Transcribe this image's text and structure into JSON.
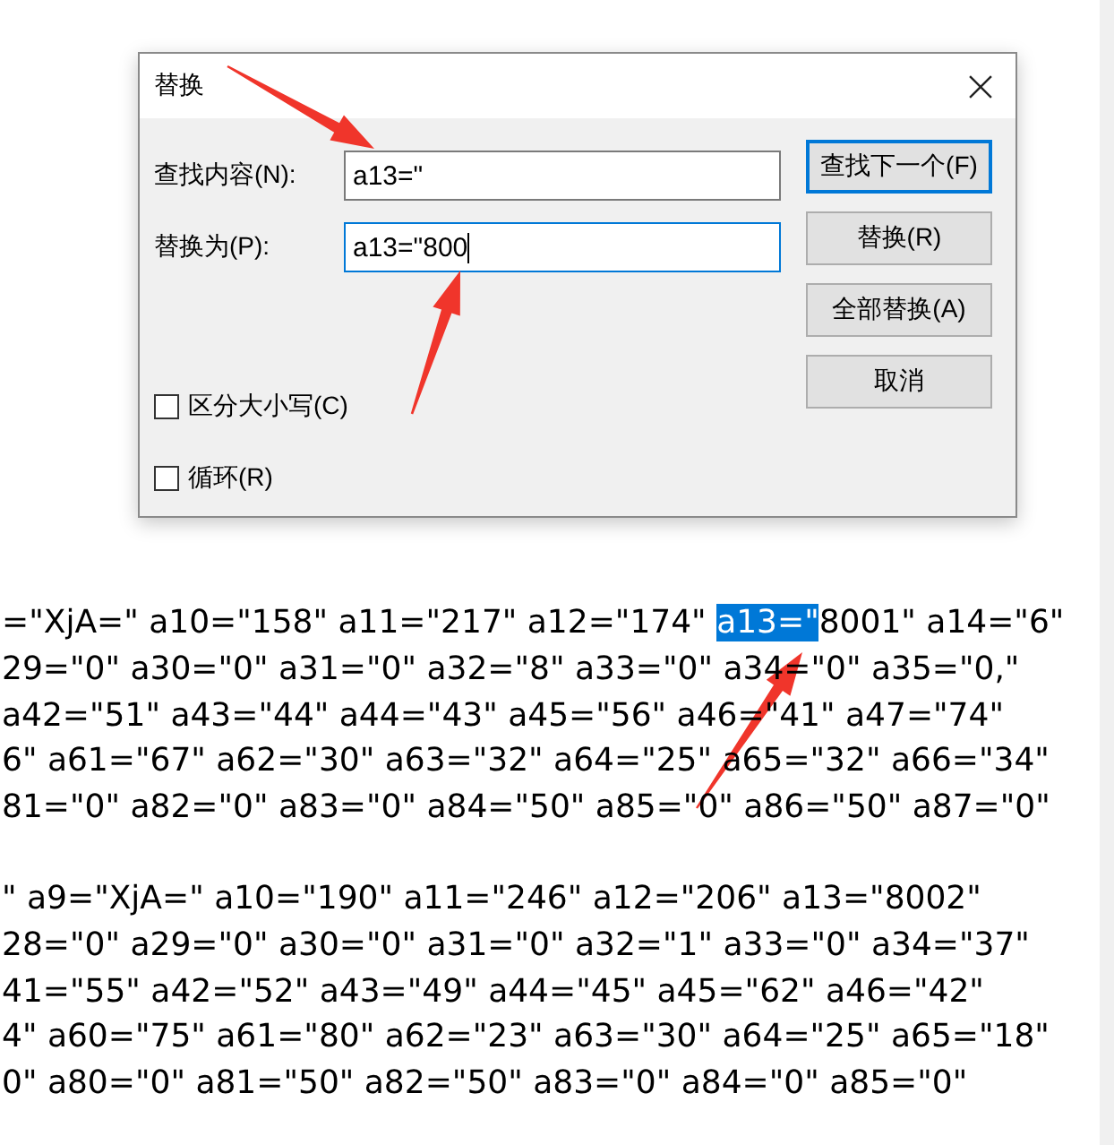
{
  "dialog": {
    "title": "替换",
    "fields": [
      {
        "label": "查找内容(N):",
        "value": "a13=\"",
        "focused": false
      },
      {
        "label": "替换为(P):",
        "value": "a13=\"800",
        "focused": true
      }
    ],
    "buttons": [
      {
        "label": "查找下一个(F)",
        "default": true
      },
      {
        "label": "替换(R)",
        "default": false
      },
      {
        "label": "全部替换(A)",
        "default": false
      },
      {
        "label": "取消",
        "default": false
      }
    ],
    "checkboxes": [
      {
        "label": "区分大小写(C)",
        "checked": false
      },
      {
        "label": "循环(R)",
        "checked": false
      }
    ]
  },
  "document": {
    "paragraphs": [
      {
        "lines": [
          {
            "segments": [
              {
                "text": "=\"XjA=\" a10=\"158\" a11=\"217\" a12=\"174\" ",
                "selected": false
              },
              {
                "text": "a13=\"",
                "selected": true
              },
              {
                "text": "8001\" a14=\"6\"",
                "selected": false
              }
            ]
          },
          {
            "segments": [
              {
                "text": "29=\"0\" a30=\"0\" a31=\"0\" a32=\"8\" a33=\"0\" a34=\"0\" a35=\"0,\"",
                "selected": false
              }
            ]
          },
          {
            "segments": [
              {
                "text": "a42=\"51\" a43=\"44\" a44=\"43\" a45=\"56\" a46=\"41\" a47=\"74\"",
                "selected": false
              }
            ]
          },
          {
            "segments": [
              {
                "text": "6\" a61=\"67\" a62=\"30\" a63=\"32\" a64=\"25\" a65=\"32\" a66=\"34\"",
                "selected": false
              }
            ]
          },
          {
            "segments": [
              {
                "text": "81=\"0\" a82=\"0\" a83=\"0\" a84=\"50\" a85=\"0\" a86=\"50\" a87=\"0\"",
                "selected": false
              }
            ]
          }
        ]
      },
      {
        "lines": [
          {
            "segments": [
              {
                "text": "\" a9=\"XjA=\" a10=\"190\" a11=\"246\" a12=\"206\" a13=\"8002\"",
                "selected": false
              }
            ]
          },
          {
            "segments": [
              {
                "text": "28=\"0\" a29=\"0\" a30=\"0\" a31=\"0\" a32=\"1\" a33=\"0\" a34=\"37\"",
                "selected": false
              }
            ]
          },
          {
            "segments": [
              {
                "text": "41=\"55\" a42=\"52\" a43=\"49\" a44=\"45\" a45=\"62\" a46=\"42\"",
                "selected": false
              }
            ]
          },
          {
            "segments": [
              {
                "text": "4\" a60=\"75\" a61=\"80\" a62=\"23\" a63=\"30\" a64=\"25\" a65=\"18\"",
                "selected": false
              }
            ]
          },
          {
            "segments": [
              {
                "text": "0\" a80=\"0\" a81=\"50\" a82=\"50\" a83=\"0\" a84=\"0\" a85=\"0\"",
                "selected": false
              }
            ]
          }
        ]
      }
    ]
  }
}
